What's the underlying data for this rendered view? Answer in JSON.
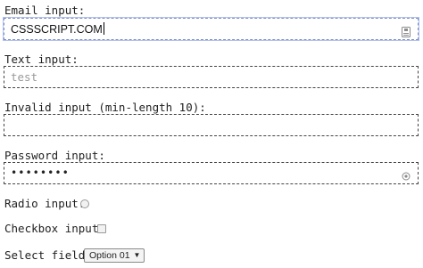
{
  "form": {
    "email": {
      "label": "Email input:",
      "value": "CSSSCRIPT.COM",
      "icon": "contact-card-icon"
    },
    "text": {
      "label": "Text input:",
      "placeholder": "test"
    },
    "invalid": {
      "label": "Invalid input (min-length 10):",
      "value": ""
    },
    "password": {
      "label": "Password input:",
      "value": "••••••••",
      "icon": "key-icon"
    },
    "radio": {
      "label": "Radio input:",
      "checked": false
    },
    "checkbox": {
      "label": "Checkbox input:",
      "checked": false
    },
    "select": {
      "label": "Select field:",
      "selected": "Option 01"
    }
  },
  "colors": {
    "focus_border": "#7a8cc9",
    "field_border": "#444444",
    "placeholder": "#9a9a9a"
  }
}
